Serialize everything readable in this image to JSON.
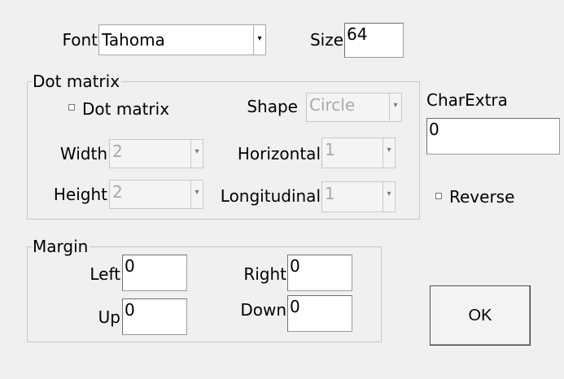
{
  "font": {
    "label": "Font",
    "value": "Tahoma"
  },
  "size": {
    "label": "Size",
    "value": "64"
  },
  "dot_matrix": {
    "group_label": "Dot matrix",
    "checkbox_label": "Dot matrix",
    "shape": {
      "label": "Shape",
      "value": "Circle"
    },
    "width": {
      "label": "Width",
      "value": "2"
    },
    "height": {
      "label": "Height",
      "value": "2"
    },
    "horizontal": {
      "label": "Horizontal",
      "value": "1"
    },
    "longitudinal": {
      "label": "Longitudinal",
      "value": "1"
    }
  },
  "char_extra": {
    "label": "CharExtra",
    "value": "0"
  },
  "reverse": {
    "label": "Reverse"
  },
  "margin": {
    "group_label": "Margin",
    "left": {
      "label": "Left",
      "value": "0"
    },
    "right": {
      "label": "Right",
      "value": "0"
    },
    "up": {
      "label": "Up",
      "value": "0"
    },
    "down": {
      "label": "Down",
      "value": "0"
    }
  },
  "ok_label": "OK"
}
